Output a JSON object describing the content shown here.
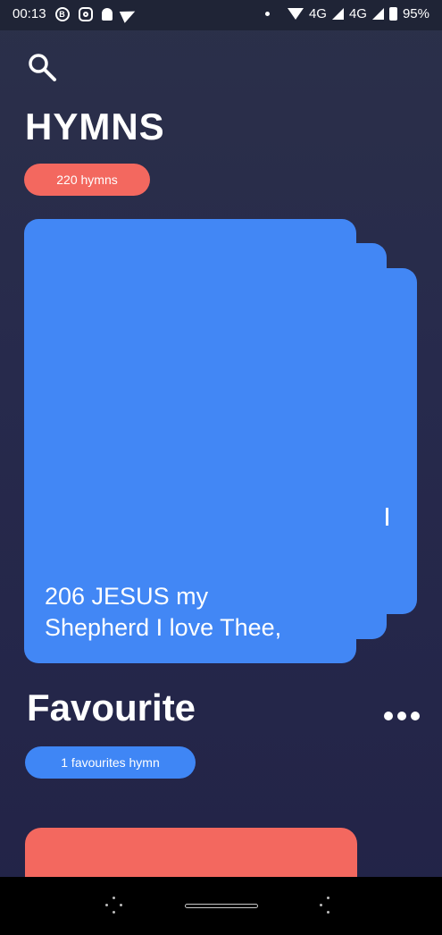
{
  "status_bar": {
    "time": "00:13",
    "network_1": "4G",
    "network_2": "4G",
    "battery": "95%"
  },
  "header": {
    "title": "HYMNS",
    "count_label": "220 hymns"
  },
  "current_card": {
    "title": "206  JESUS my Shepherd I love Thee,"
  },
  "favourite": {
    "title": "Favourite",
    "count_label": "1 favourites hymn"
  },
  "colors": {
    "accent_red": "#f3685f",
    "accent_blue": "#4287f5",
    "background": "#25274a"
  },
  "icons": [
    "search-icon",
    "more-icon",
    "bell-icon",
    "telegram-icon",
    "instagram-icon",
    "wifi-icon",
    "signal-icon",
    "battery-icon"
  ]
}
